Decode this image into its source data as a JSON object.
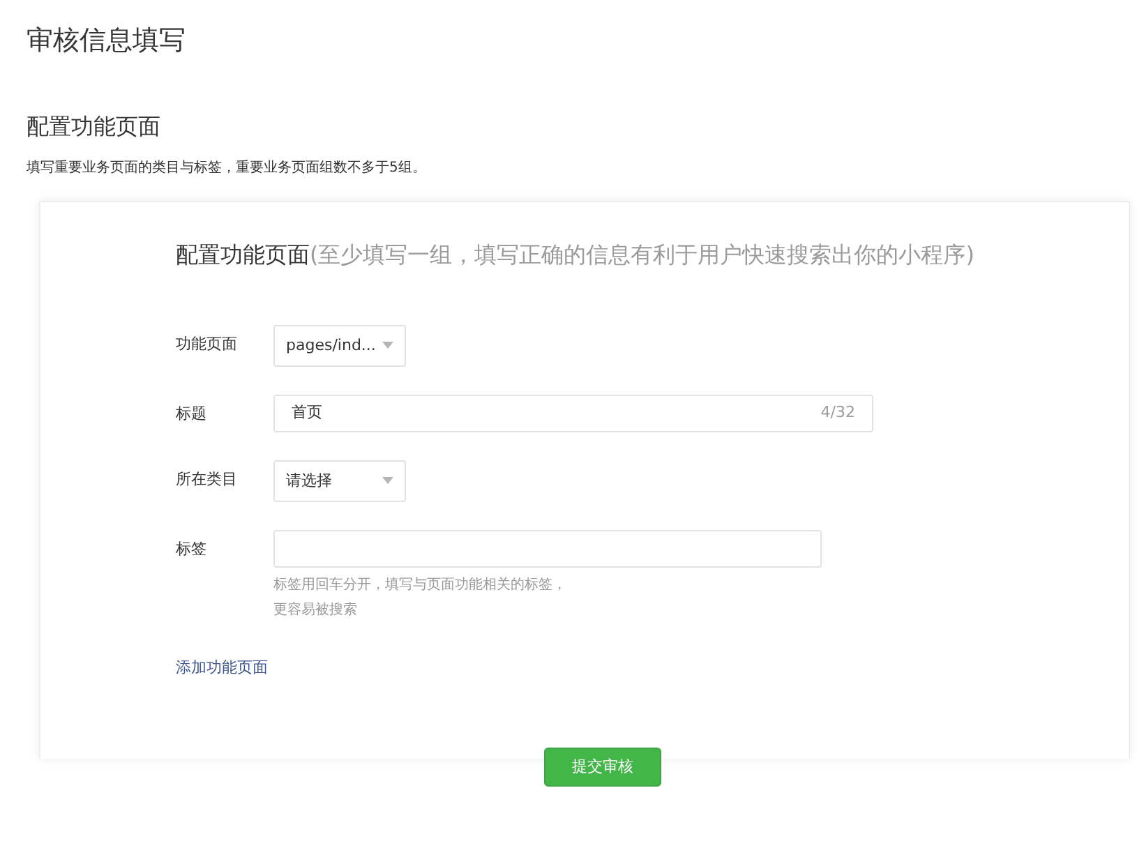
{
  "page_title": "审核信息填写",
  "section": {
    "title": "配置功能页面",
    "description": "填写重要业务页面的类目与标签，重要业务页面组数不多于5组。"
  },
  "card": {
    "title": "配置功能页面",
    "subtitle": "(至少填写一组，填写正确的信息有利于用户快速搜索出你的小程序)",
    "fields": [
      {
        "kind": "select",
        "label": "功能页面",
        "value": "pages/ind..."
      },
      {
        "kind": "text",
        "label": "标题",
        "value": "首页",
        "counter": "4/32"
      },
      {
        "kind": "select",
        "label": "所在类目",
        "value": "请选择"
      },
      {
        "kind": "tags",
        "label": "标签",
        "hint": [
          "标签用回车分开，填写与页面功能相关的标签，",
          "更容易被搜索"
        ]
      }
    ],
    "add_link": "添加功能页面",
    "submit": "提交审核"
  }
}
